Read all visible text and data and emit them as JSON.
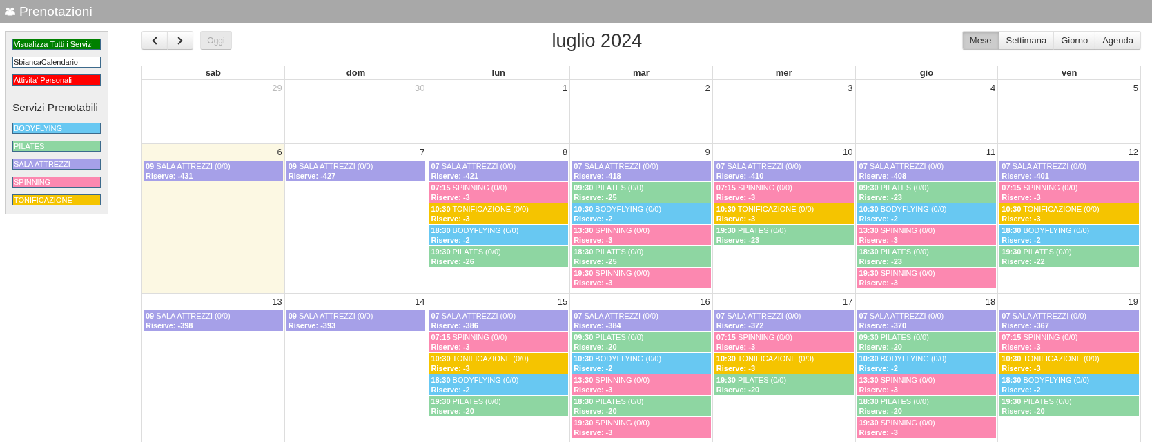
{
  "header": {
    "title": "Prenotazioni"
  },
  "sidebar": {
    "actions": [
      {
        "label": "Visualizza Tutti i Servizi",
        "color": "#008000"
      },
      {
        "label": "SbiancaCalendario",
        "color": "#ffffff"
      },
      {
        "label": "Attivita' Personali",
        "color": "#ff0000"
      }
    ],
    "services_title": "Servizi Prenotabili",
    "services": [
      {
        "label": "BODYFLYING",
        "color": "#68c8f2"
      },
      {
        "label": "PILATES",
        "color": "#8ed6a2"
      },
      {
        "label": "SALA ATTREZZI",
        "color": "#a6a0e8"
      },
      {
        "label": "SPINNING",
        "color": "#fc88b0"
      },
      {
        "label": "TONIFICAZIONE",
        "color": "#f5c400"
      }
    ]
  },
  "calendar": {
    "today_button": {
      "label": "Oggi",
      "disabled": true
    },
    "title": "luglio 2024",
    "views": [
      {
        "label": "Mese",
        "selected": true
      },
      {
        "label": "Settimana",
        "selected": false
      },
      {
        "label": "Giorno",
        "selected": false
      },
      {
        "label": "Agenda",
        "selected": false
      }
    ],
    "weekdays": [
      "sab",
      "dom",
      "lun",
      "mar",
      "mer",
      "gio",
      "ven"
    ],
    "weeks": [
      {
        "days": [
          {
            "number": "29",
            "other_month": true,
            "today": false
          },
          {
            "number": "30",
            "other_month": true,
            "today": false
          },
          {
            "number": "1",
            "other_month": false,
            "today": false
          },
          {
            "number": "2",
            "other_month": false,
            "today": false
          },
          {
            "number": "3",
            "other_month": false,
            "today": false
          },
          {
            "number": "4",
            "other_month": false,
            "today": false
          },
          {
            "number": "5",
            "other_month": false,
            "today": false
          }
        ]
      },
      {
        "days": [
          {
            "number": "6",
            "other_month": false,
            "today": true,
            "events": [
              {
                "title": "**09** SALA ATTREZZI (0/0)",
                "reserves": "Riserve: -431",
                "color": "#a6a0e8"
              }
            ]
          },
          {
            "number": "7",
            "other_month": false,
            "today": false,
            "events": [
              {
                "title": "**09** SALA ATTREZZI (0/0)",
                "reserves": "Riserve: -427",
                "color": "#a6a0e8"
              }
            ]
          },
          {
            "number": "8",
            "other_month": false,
            "today": false,
            "events": [
              {
                "title": "**07** SALA ATTREZZI (0/0)",
                "reserves": "Riserve: -421",
                "color": "#a6a0e8"
              },
              {
                "title": "**07:15** SPINNING (0/0)",
                "reserves": "Riserve: -3",
                "color": "#fc88b0"
              },
              {
                "title": "**10:30** TONIFICAZIONE (0/0)",
                "reserves": "Riserve: -3",
                "color": "#f5c400"
              },
              {
                "title": "**18:30** BODYFLYING (0/0)",
                "reserves": "Riserve: -2",
                "color": "#68c8f2"
              },
              {
                "title": "**19:30** PILATES (0/0)",
                "reserves": "Riserve: -26",
                "color": "#8ed6a2"
              }
            ]
          },
          {
            "number": "9",
            "other_month": false,
            "today": false,
            "events": [
              {
                "title": "**07** SALA ATTREZZI (0/0)",
                "reserves": "Riserve: -418",
                "color": "#a6a0e8"
              },
              {
                "title": "**09:30** PILATES (0/0)",
                "reserves": "Riserve: -25",
                "color": "#8ed6a2"
              },
              {
                "title": "**10:30** BODYFLYING (0/0)",
                "reserves": "Riserve: -2",
                "color": "#68c8f2"
              },
              {
                "title": "**13:30** SPINNING (0/0)",
                "reserves": "Riserve: -3",
                "color": "#fc88b0"
              },
              {
                "title": "**18:30** PILATES (0/0)",
                "reserves": "Riserve: -25",
                "color": "#8ed6a2"
              },
              {
                "title": "**19:30** SPINNING (0/0)",
                "reserves": "Riserve: -3",
                "color": "#fc88b0"
              }
            ]
          },
          {
            "number": "10",
            "other_month": false,
            "today": false,
            "events": [
              {
                "title": "**07** SALA ATTREZZI (0/0)",
                "reserves": "Riserve: -410",
                "color": "#a6a0e8"
              },
              {
                "title": "**07:15** SPINNING (0/0)",
                "reserves": "Riserve: -3",
                "color": "#fc88b0"
              },
              {
                "title": "**10:30** TONIFICAZIONE (0/0)",
                "reserves": "Riserve: -3",
                "color": "#f5c400"
              },
              {
                "title": "**19:30** PILATES (0/0)",
                "reserves": "Riserve: -23",
                "color": "#8ed6a2"
              }
            ]
          },
          {
            "number": "11",
            "other_month": false,
            "today": false,
            "events": [
              {
                "title": "**07** SALA ATTREZZI (0/0)",
                "reserves": "Riserve: -408",
                "color": "#a6a0e8"
              },
              {
                "title": "**09:30** PILATES (0/0)",
                "reserves": "Riserve: -23",
                "color": "#8ed6a2"
              },
              {
                "title": "**10:30** BODYFLYING (0/0)",
                "reserves": "Riserve: -2",
                "color": "#68c8f2"
              },
              {
                "title": "**13:30** SPINNING (0/0)",
                "reserves": "Riserve: -3",
                "color": "#fc88b0"
              },
              {
                "title": "**18:30** PILATES (0/0)",
                "reserves": "Riserve: -23",
                "color": "#8ed6a2"
              },
              {
                "title": "**19:30** SPINNING (0/0)",
                "reserves": "Riserve: -3",
                "color": "#fc88b0"
              }
            ]
          },
          {
            "number": "12",
            "other_month": false,
            "today": false,
            "events": [
              {
                "title": "**07** SALA ATTREZZI (0/0)",
                "reserves": "Riserve: -401",
                "color": "#a6a0e8"
              },
              {
                "title": "**07:15** SPINNING (0/0)",
                "reserves": "Riserve: -3",
                "color": "#fc88b0"
              },
              {
                "title": "**10:30** TONIFICAZIONE (0/0)",
                "reserves": "Riserve: -3",
                "color": "#f5c400"
              },
              {
                "title": "**18:30** BODYFLYING (0/0)",
                "reserves": "Riserve: -2",
                "color": "#68c8f2"
              },
              {
                "title": "**19:30** PILATES (0/0)",
                "reserves": "Riserve: -22",
                "color": "#8ed6a2"
              }
            ]
          }
        ]
      },
      {
        "days": [
          {
            "number": "13",
            "other_month": false,
            "today": false,
            "events": [
              {
                "title": "**09** SALA ATTREZZI (0/0)",
                "reserves": "Riserve: -398",
                "color": "#a6a0e8"
              }
            ]
          },
          {
            "number": "14",
            "other_month": false,
            "today": false,
            "events": [
              {
                "title": "**09** SALA ATTREZZI (0/0)",
                "reserves": "Riserve: -393",
                "color": "#a6a0e8"
              }
            ]
          },
          {
            "number": "15",
            "other_month": false,
            "today": false,
            "events": [
              {
                "title": "**07** SALA ATTREZZI (0/0)",
                "reserves": "Riserve: -386",
                "color": "#a6a0e8"
              },
              {
                "title": "**07:15** SPINNING (0/0)",
                "reserves": "Riserve: -3",
                "color": "#fc88b0"
              },
              {
                "title": "**10:30** TONIFICAZIONE (0/0)",
                "reserves": "Riserve: -3",
                "color": "#f5c400"
              },
              {
                "title": "**18:30** BODYFLYING (0/0)",
                "reserves": "Riserve: -2",
                "color": "#68c8f2"
              },
              {
                "title": "**19:30** PILATES (0/0)",
                "reserves": "Riserve: -20",
                "color": "#8ed6a2"
              }
            ]
          },
          {
            "number": "16",
            "other_month": false,
            "today": false,
            "events": [
              {
                "title": "**07** SALA ATTREZZI (0/0)",
                "reserves": "Riserve: -384",
                "color": "#a6a0e8"
              },
              {
                "title": "**09:30** PILATES (0/0)",
                "reserves": "Riserve: -20",
                "color": "#8ed6a2"
              },
              {
                "title": "**10:30** BODYFLYING (0/0)",
                "reserves": "Riserve: -2",
                "color": "#68c8f2"
              },
              {
                "title": "**13:30** SPINNING (0/0)",
                "reserves": "Riserve: -3",
                "color": "#fc88b0"
              },
              {
                "title": "**18:30** PILATES (0/0)",
                "reserves": "Riserve: -20",
                "color": "#8ed6a2"
              },
              {
                "title": "**19:30** SPINNING (0/0)",
                "reserves": "Riserve: -3",
                "color": "#fc88b0"
              }
            ]
          },
          {
            "number": "17",
            "other_month": false,
            "today": false,
            "events": [
              {
                "title": "**07** SALA ATTREZZI (0/0)",
                "reserves": "Riserve: -372",
                "color": "#a6a0e8"
              },
              {
                "title": "**07:15** SPINNING (0/0)",
                "reserves": "Riserve: -3",
                "color": "#fc88b0"
              },
              {
                "title": "**10:30** TONIFICAZIONE (0/0)",
                "reserves": "Riserve: -3",
                "color": "#f5c400"
              },
              {
                "title": "**19:30** PILATES (0/0)",
                "reserves": "Riserve: -20",
                "color": "#8ed6a2"
              }
            ]
          },
          {
            "number": "18",
            "other_month": false,
            "today": false,
            "events": [
              {
                "title": "**07** SALA ATTREZZI (0/0)",
                "reserves": "Riserve: -370",
                "color": "#a6a0e8"
              },
              {
                "title": "**09:30** PILATES (0/0)",
                "reserves": "Riserve: -20",
                "color": "#8ed6a2"
              },
              {
                "title": "**10:30** BODYFLYING (0/0)",
                "reserves": "Riserve: -2",
                "color": "#68c8f2"
              },
              {
                "title": "**13:30** SPINNING (0/0)",
                "reserves": "Riserve: -3",
                "color": "#fc88b0"
              },
              {
                "title": "**18:30** PILATES (0/0)",
                "reserves": "Riserve: -20",
                "color": "#8ed6a2"
              },
              {
                "title": "**19:30** SPINNING (0/0)",
                "reserves": "Riserve: -3",
                "color": "#fc88b0"
              }
            ]
          },
          {
            "number": "19",
            "other_month": false,
            "today": false,
            "events": [
              {
                "title": "**07** SALA ATTREZZI (0/0)",
                "reserves": "Riserve: -367",
                "color": "#a6a0e8"
              },
              {
                "title": "**07:15** SPINNING (0/0)",
                "reserves": "Riserve: -3",
                "color": "#fc88b0"
              },
              {
                "title": "**10:30** TONIFICAZIONE (0/0)",
                "reserves": "Riserve: -3",
                "color": "#f5c400"
              },
              {
                "title": "**18:30** BODYFLYING (0/0)",
                "reserves": "Riserve: -2",
                "color": "#68c8f2"
              },
              {
                "title": "**19:30** PILATES (0/0)",
                "reserves": "Riserve: -20",
                "color": "#8ed6a2"
              }
            ]
          }
        ]
      }
    ]
  }
}
